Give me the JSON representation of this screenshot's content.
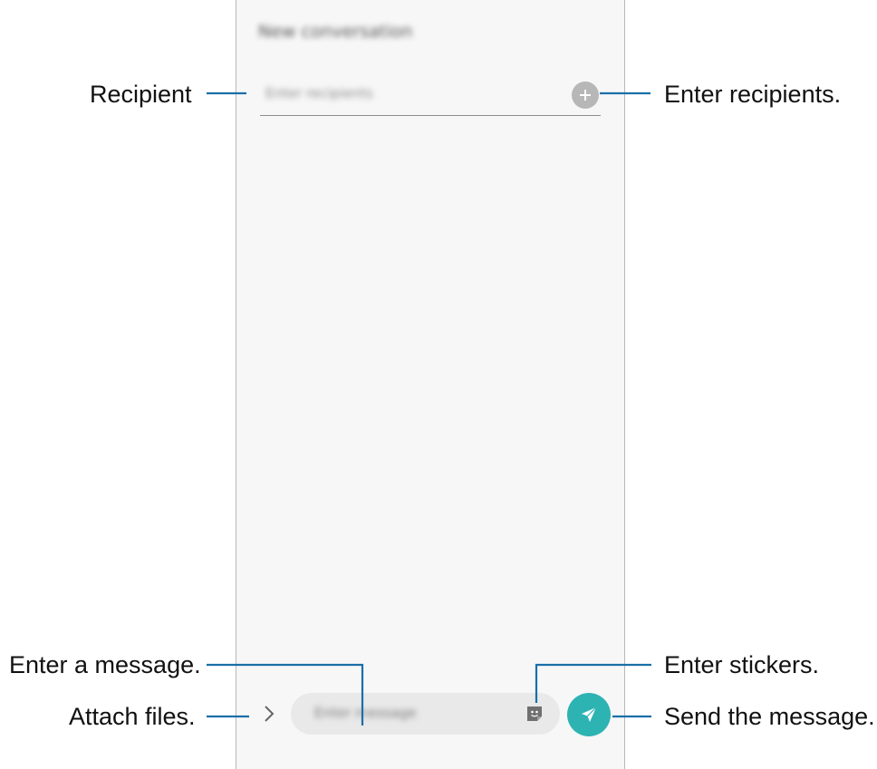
{
  "screen": {
    "title": "New conversation",
    "recipient_placeholder": "Enter recipients",
    "compose_placeholder": "Enter message"
  },
  "icons": {
    "add_recipient": "plus-icon",
    "attach": "chevron-right-icon",
    "sticker": "sticker-icon",
    "send": "send-icon"
  },
  "colors": {
    "send_button": "#2eb3b3",
    "callout_line": "#1a6fa8",
    "add_button": "#b7b7b7",
    "compose_bar": "#e9e9e9"
  },
  "callouts": {
    "recipient": "Recipient",
    "enter_recipients": "Enter recipients.",
    "enter_message": "Enter a message.",
    "enter_stickers": "Enter stickers.",
    "attach_files": "Attach files.",
    "send_message": "Send the message."
  }
}
